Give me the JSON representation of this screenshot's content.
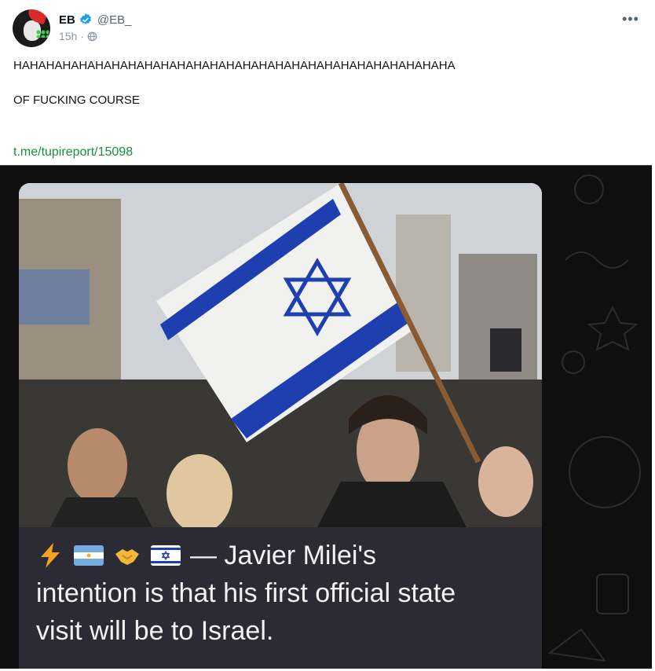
{
  "post": {
    "author_name": "EB",
    "author_handle": "@EB_",
    "time": "15h",
    "separator": "·",
    "text_line1": "HAHAHAHAHAHAHAHAHAHAHAHAHAHAHAHAHAHAHAHAHAHAHAHAHAHAHA",
    "text_line2": "OF FUCKING COURSE",
    "link": "t.me/tupireport/15098",
    "more_label": "•••"
  },
  "media": {
    "caption_line1": "— Javier Milei's",
    "caption_line2": "intention is that his first official state",
    "caption_line3": "visit will be to Israel.",
    "icons": [
      "lightning-icon",
      "argentina-flag-icon",
      "handshake-icon",
      "israel-flag-icon"
    ]
  },
  "colors": {
    "link": "#1a8f3f",
    "verified": "#1d9bf0",
    "flag_blue": "#1e3fb0"
  }
}
